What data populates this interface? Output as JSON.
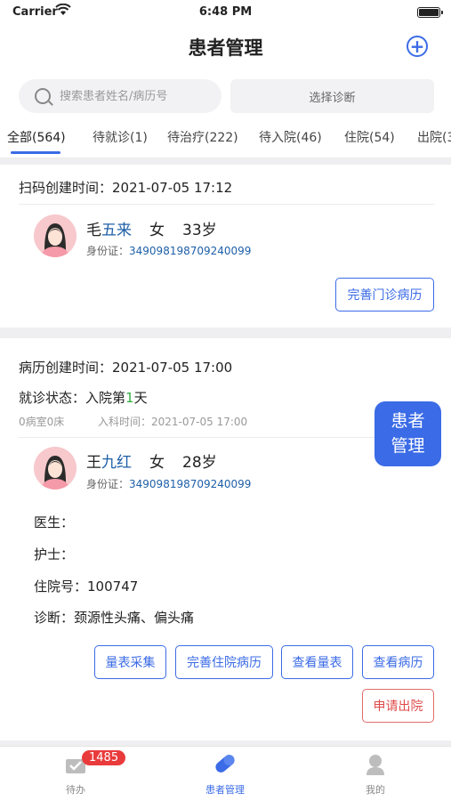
{
  "status_bar": {
    "carrier": "Carrier",
    "time": "6:48 PM"
  },
  "header": {
    "title": "患者管理"
  },
  "search": {
    "placeholder": "搜索患者姓名/病历号",
    "diagnosis_label": "选择诊断"
  },
  "tabs": [
    {
      "label": "全部(564)"
    },
    {
      "label": "待就诊(1)"
    },
    {
      "label": "待治疗(222)"
    },
    {
      "label": "待入院(46)"
    },
    {
      "label": "住院(54)"
    },
    {
      "label": "出院(3"
    }
  ],
  "cards": [
    {
      "created_label": "扫码创建时间：",
      "created_time": "2021-07-05 17:12",
      "name_surname": "毛",
      "name_given": "五来",
      "gender": "女",
      "age": "33岁",
      "id_label": "身份证：",
      "id_number": "349098198709240099",
      "button": "完善门诊病历"
    },
    {
      "created_label": "病历创建时间：",
      "created_time": "2021-07-05 17:00",
      "visit_label": "就诊状态：",
      "visit_prefix": "入院第",
      "visit_day": "1",
      "visit_suffix": "天",
      "room_bed": "0病室0床",
      "admit_label": "入科时间：",
      "admit_time": "2021-07-05 17:00",
      "name_surname": "王",
      "name_given": "九红",
      "gender": "女",
      "age": "28岁",
      "id_label": "身份证：",
      "id_number": "349098198709240099",
      "doctor_label": "医生：",
      "nurse_label": "护士：",
      "admission_no_label": "住院号：",
      "admission_no": "100747",
      "diagnosis_label": "诊断：",
      "diagnosis": "颈源性头痛、偏头痛",
      "buttons": [
        "量表采集",
        "完善住院病历",
        "查看量表",
        "查看病历"
      ],
      "discharge_button": "申请出院"
    }
  ],
  "floating_button": {
    "line1": "患者",
    "line2": "管理"
  },
  "bottom_nav": [
    {
      "label": "待办",
      "badge": "1485"
    },
    {
      "label": "患者管理"
    },
    {
      "label": "我的"
    }
  ],
  "colors": {
    "accent": "#3b6be6",
    "danger": "#e04a4a",
    "badge": "#e93b3b"
  }
}
